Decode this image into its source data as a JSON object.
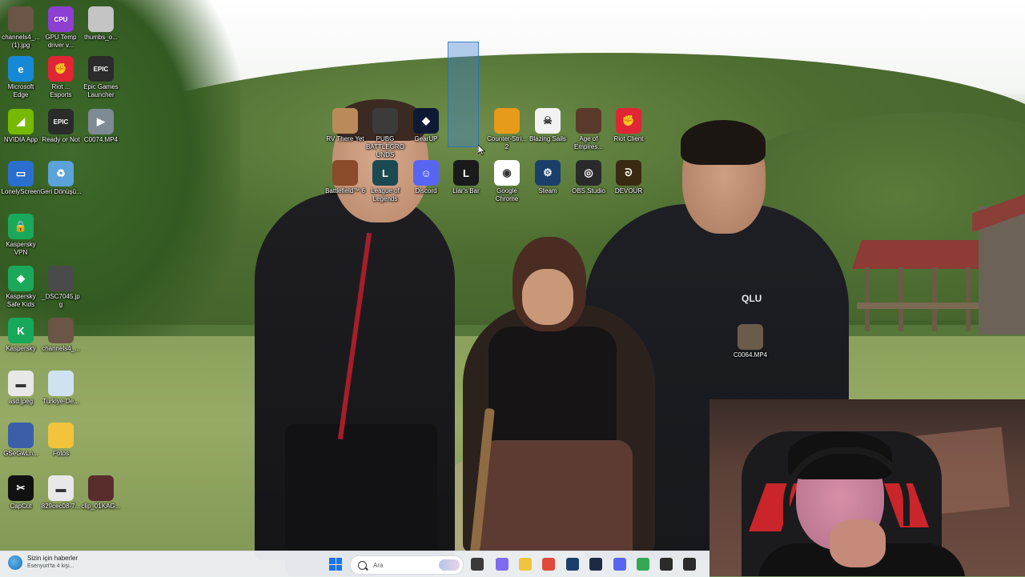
{
  "desktop": {
    "left_icons": [
      {
        "name": "channels4-jpg",
        "label": "channels4_... (1).jpg",
        "glyph": "",
        "color": "#6b5546"
      },
      {
        "name": "gpu-temp",
        "label": "GPU Temp driver v...",
        "glyph": "CPU",
        "color": "#8c3fd1"
      },
      {
        "name": "thumbs",
        "label": "thumbs_o...",
        "glyph": "",
        "color": "#c4c4c4"
      },
      {
        "name": "microsoft-edge",
        "label": "Microsoft Edge",
        "glyph": "e",
        "color": "#1689d6"
      },
      {
        "name": "riot-esports",
        "label": "Riot ... Esports",
        "glyph": "✊",
        "color": "#e02535"
      },
      {
        "name": "epic-games-launcher",
        "label": "Epic Games Launcher",
        "glyph": "EPIC",
        "color": "#2b2b2b"
      },
      {
        "name": "nvidia-app",
        "label": "NVIDIA App",
        "glyph": "◢",
        "color": "#76b900"
      },
      {
        "name": "ready-or-not",
        "label": "Ready or Not",
        "glyph": "EPIC",
        "color": "#2b2b2b"
      },
      {
        "name": "c0074-mp4",
        "label": "C0074.MP4",
        "glyph": "▶",
        "color": "#7e8a94"
      },
      {
        "name": "lonelyscreen",
        "label": "LonelyScreen",
        "glyph": "▭",
        "color": "#2b6fce"
      },
      {
        "name": "recycle-bin",
        "label": "Geri Dönüşü...",
        "glyph": "♻",
        "color": "#5aa2d8"
      },
      {
        "name": "kaspersky-vpn",
        "label": "Kaspersky VPN",
        "glyph": "🔒",
        "color": "#1aa85a"
      },
      {
        "name": "kaspersky-safe-kids",
        "label": "Kaspersky Safe Kids",
        "glyph": "◈",
        "color": "#1aa85a"
      },
      {
        "name": "dsc7045-jpg",
        "label": "_DSC7045.jpg",
        "glyph": "",
        "color": "#4a4a4a"
      },
      {
        "name": "kaspersky",
        "label": "Kaspersky",
        "glyph": "K",
        "color": "#18a85b"
      },
      {
        "name": "channels4-2",
        "label": "channels4_...",
        "glyph": "",
        "color": "#6b5546"
      },
      {
        "name": "asd-jpeg",
        "label": "asd.jpeg",
        "glyph": "▬",
        "color": "#e8e8e8"
      },
      {
        "name": "turkiye-de",
        "label": "Turkiye-De...",
        "glyph": "",
        "color": "#cfe2f2"
      },
      {
        "name": "gsegwln",
        "label": "GSeGwLn...",
        "glyph": "",
        "color": "#3a5fa8"
      },
      {
        "name": "fotos",
        "label": "Fotos",
        "glyph": "",
        "color": "#f2c43d"
      },
      {
        "name": "capcut",
        "label": "CapCut",
        "glyph": "✂",
        "color": "#111111"
      },
      {
        "name": "829cec08",
        "label": "829cec08-7...",
        "glyph": "▬",
        "color": "#e8e8e8"
      },
      {
        "name": "clip-01kag",
        "label": "clip_01KAG...",
        "glyph": "",
        "color": "#5a2d2d"
      }
    ],
    "center_icons": [
      {
        "name": "rv-there-yet",
        "label": "RV There Yet",
        "glyph": "",
        "color": "#b98b5b"
      },
      {
        "name": "pubg",
        "label": "PUBG BATTLEGROUNDS",
        "glyph": "",
        "color": "#3b3b3b"
      },
      {
        "name": "gearup",
        "label": "GearUP",
        "glyph": "◆",
        "color": "#0e1a33"
      },
      {
        "name": "counter-strike-2",
        "label": "Counter-Stri... 2",
        "glyph": "",
        "color": "#e89a1a"
      },
      {
        "name": "blazing-sails",
        "label": "Blazing Sails",
        "glyph": "☠",
        "color": "#f2f2f2"
      },
      {
        "name": "age-of-empires",
        "label": "Age of Empires...",
        "glyph": "",
        "color": "#5a3a2a"
      },
      {
        "name": "riot-client",
        "label": "Riot Client",
        "glyph": "✊",
        "color": "#e02535"
      },
      {
        "name": "battlefield-6",
        "label": "Battlefield™ 6",
        "glyph": "",
        "color": "#8b4a2a"
      },
      {
        "name": "league-of-legends",
        "label": "League of Legends",
        "glyph": "L",
        "color": "#1c4a52"
      },
      {
        "name": "discord",
        "label": "Discord",
        "glyph": "☺",
        "color": "#5865f2"
      },
      {
        "name": "liars-bar",
        "label": "Liar's Bar",
        "glyph": "L",
        "color": "#1a1a1a"
      },
      {
        "name": "google-chrome",
        "label": "Google Chrome",
        "glyph": "◉",
        "color": "#ffffff"
      },
      {
        "name": "steam",
        "label": "Steam",
        "glyph": "⚙",
        "color": "#1b3f6a"
      },
      {
        "name": "obs-studio",
        "label": "OBS Studio",
        "glyph": "◎",
        "color": "#2a2a2a"
      },
      {
        "name": "devour",
        "label": "DEVOUR",
        "glyph": "ᘐ",
        "color": "#3a2a12"
      }
    ],
    "extra_icons": [
      {
        "name": "c0064-mp4",
        "label": "C0064.MP4",
        "glyph": "",
        "color": "#6b5b4a"
      }
    ]
  },
  "wallpaper": {
    "hoodie_logo": "QLU"
  },
  "taskbar": {
    "news_title": "Sizin için haberler",
    "news_subtitle": "Esenyurt'ta 4 kişi...",
    "search_placeholder": "Ara",
    "pinned": [
      {
        "name": "file-manager-icon",
        "color": "#3a3a3a"
      },
      {
        "name": "copilot-icon",
        "color": "#7b6cf0"
      },
      {
        "name": "explorer-icon",
        "color": "#f2c43d"
      },
      {
        "name": "chrome-icon",
        "color": "#e04a3a"
      },
      {
        "name": "steam-icon",
        "color": "#1b3f6a"
      },
      {
        "name": "vscode-icon",
        "color": "#1e2a44"
      },
      {
        "name": "discord-icon",
        "color": "#5865f2"
      },
      {
        "name": "chrome-alt-icon",
        "color": "#34a853"
      },
      {
        "name": "obs-icon",
        "color": "#2a2a2a"
      },
      {
        "name": "epic-icon",
        "color": "#2b2b2b"
      }
    ]
  },
  "colors": {
    "accent": "#1a73e8",
    "selection": "#3c82d2"
  }
}
